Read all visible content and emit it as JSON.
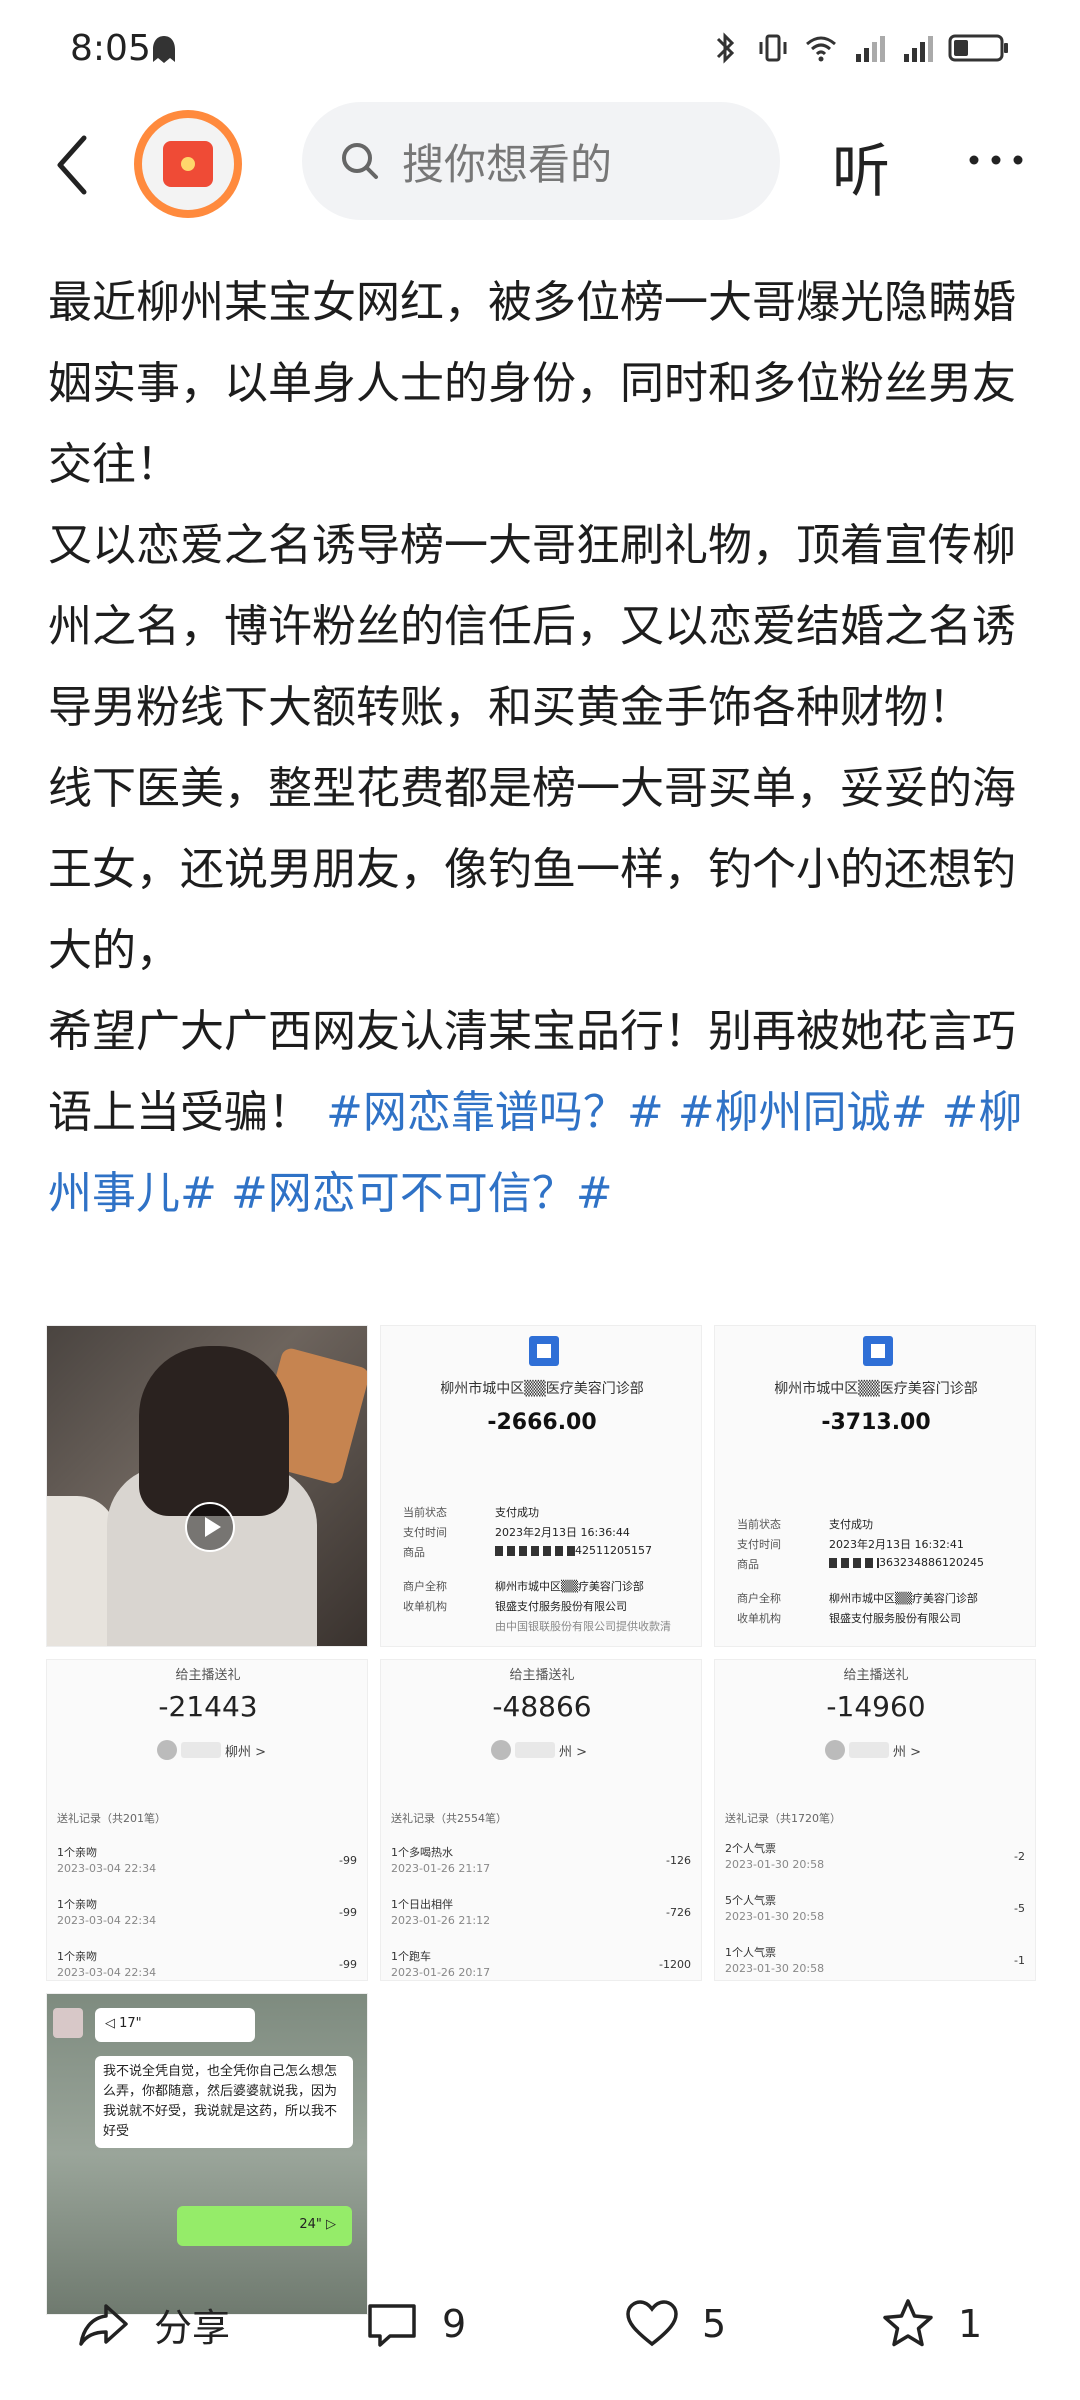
{
  "status_bar": {
    "time": "8:05",
    "icons": [
      "ghost-icon",
      "bluetooth-icon",
      "vibrate-icon",
      "wifi-icon",
      "signal-icon",
      "signal-icon",
      "battery-icon"
    ]
  },
  "header": {
    "search_placeholder": "搜你想看的",
    "listen_label": "听",
    "avatar_icon": "red-envelope-icon"
  },
  "post": {
    "paragraphs": [
      "最近柳州某宝女网红，被多位榜一大哥爆光隐瞒婚姻实事，以单身人士的身份，同时和多位粉丝男友交往！",
      "又以恋爱之名诱导榜一大哥狂刷礼物，顶着宣传柳州之名，博许粉丝的信任后，又以恋爱结婚之名诱导男粉线下大额转账，和买黄金手饰各种财物！",
      "线下医美，整型花费都是榜一大哥买单，妥妥的海王女，还说男朋友，像钓鱼一样，钓个小的还想钓大的，",
      "希望广大广西网友认清某宝品行！别再被她花言巧语上当受骗！"
    ],
    "tags": [
      "#网恋靠谱吗？#",
      "#柳州同诚#",
      "#柳州事儿#",
      "#网恋可不可信？#"
    ]
  },
  "receipts": [
    {
      "merchant": "柳州市城中区",
      "merchant_suffix": "医疗美容门诊部",
      "amount": "-2666.00",
      "status_label": "当前状态",
      "status": "支付成功",
      "time_label": "支付时间",
      "time": "2023年2月13日 16:36:44",
      "goods_label": "商品",
      "goods": "4251120515​7",
      "merchant_label": "商户全称",
      "merchant_full": "柳州市城中区",
      "merchant_full_suffix": "疗美容门诊部",
      "acquirer_label": "收单机构",
      "acquirer": "银盛支付服务股份有限公司",
      "footer": "由中国银联股份有限公司提供收款清"
    },
    {
      "merchant": "柳州市城中区",
      "merchant_suffix": "医疗美容门诊部",
      "amount": "-3713.00",
      "status_label": "当前状态",
      "status": "支付成功",
      "time_label": "支付时间",
      "time": "2023年2月13日 16:32:41",
      "goods_label": "商品",
      "goods": "363234886120245",
      "merchant_label": "商户全称",
      "merchant_full": "柳州市城中区",
      "merchant_full_suffix": "疗美容门诊部",
      "acquirer_label": "收单机构",
      "acquirer": "银盛支付服务股份有限公司",
      "footer": ""
    }
  ],
  "gifts": [
    {
      "title": "给主播送礼",
      "amount": "-21443",
      "user_suffix": "柳州 >",
      "count": "送礼记录（共201笔）",
      "items": [
        {
          "name": "1个亲吻",
          "date": "2023-03-04 22:34",
          "value": "-99"
        },
        {
          "name": "1个亲吻",
          "date": "2023-03-04 22:34",
          "value": "-99"
        },
        {
          "name": "1个亲吻",
          "date": "2023-03-04 22:34",
          "value": "-99"
        }
      ]
    },
    {
      "title": "给主播送礼",
      "amount": "-48866",
      "user_suffix": "州 >",
      "count": "送礼记录（共2554笔）",
      "items": [
        {
          "name": "1个多喝热水",
          "date": "2023-01-26 21:17",
          "value": "-126"
        },
        {
          "name": "1个日出相伴",
          "date": "2023-01-26 21:12",
          "value": "-726"
        },
        {
          "name": "1个跑车",
          "date": "2023-01-26 20:17",
          "value": "-1200"
        }
      ]
    },
    {
      "title": "给主播送礼",
      "amount": "-14960",
      "user_suffix": "州 >",
      "count": "送礼记录（共1720笔）",
      "items": [
        {
          "name": "2个人气票",
          "date": "2023-01-30 20:58",
          "value": "-2"
        },
        {
          "name": "5个人气票",
          "date": "2023-01-30 20:58",
          "value": "-5"
        },
        {
          "name": "1个人气票",
          "date": "2023-01-30 20:58",
          "value": "-1"
        }
      ]
    }
  ],
  "chat": {
    "voice_in": "17\"",
    "message": "我不说全凭自觉，也全凭你自己怎么想怎么弄，你都随意，然后婆婆就说我，因为我说就不好受，我说就是这药，所以我不好受",
    "voice_out": "24\""
  },
  "bottom_bar": {
    "share_label": "分享",
    "comment_count": "9",
    "like_count": "5",
    "favorite_count": "1"
  },
  "colors": {
    "tag_blue": "#2f72c6",
    "avatar_ring": "#ff8a3d",
    "search_bg": "#f2f3f5"
  }
}
